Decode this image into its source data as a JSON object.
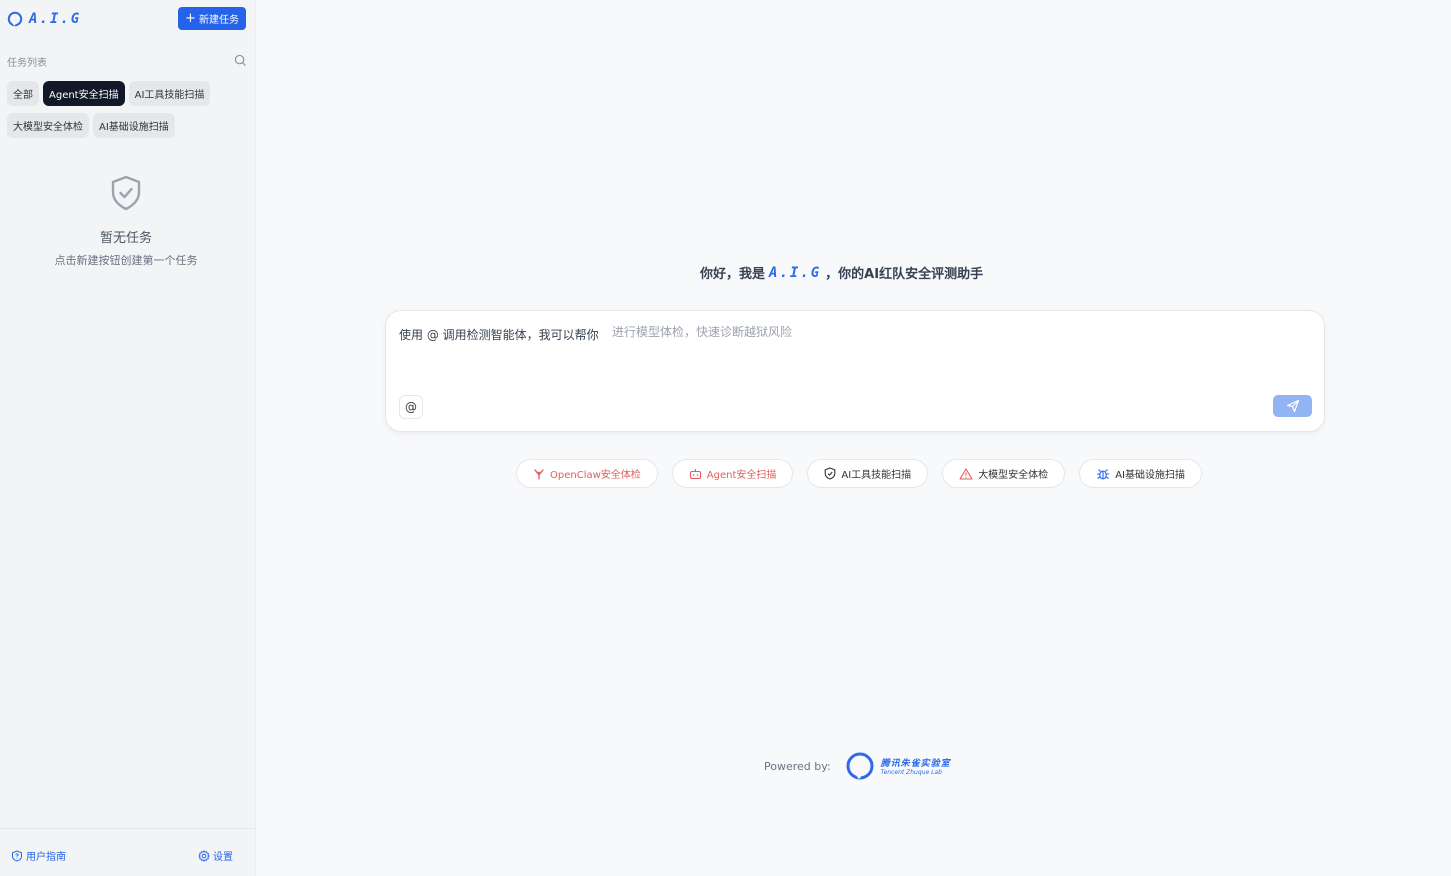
{
  "sidebar": {
    "logo_text": "A.I.G",
    "new_task_label": "新建任务",
    "task_list_label": "任务列表",
    "filters_row1": [
      "全部",
      "Agent安全扫描",
      "AI工具技能扫描"
    ],
    "filters_row2": [
      "大模型安全体检",
      "AI基础设施扫描"
    ],
    "active_filter": "Agent安全扫描",
    "empty_title": "暂无任务",
    "empty_subtitle": "点击新建按钮创建第一个任务",
    "footer": {
      "guide_label": "用户指南",
      "settings_label": "设置"
    }
  },
  "main": {
    "greeting_prefix": "你好，我是",
    "greeting_brand": "A.I.G",
    "greeting_suffix": "，你的AI红队安全评测助手",
    "input": {
      "prefix": "使用 @ 调用检测智能体，我可以帮你",
      "placeholder": "进行模型体检，快速诊断越狱风险",
      "value": ""
    },
    "at_symbol": "@",
    "quick_actions": [
      {
        "label": "OpenClaw安全体检",
        "icon": "claw-icon",
        "color": "#e35d5d"
      },
      {
        "label": "Agent安全扫描",
        "icon": "robot-icon",
        "color": "#e35d5d"
      },
      {
        "label": "AI工具技能扫描",
        "icon": "shield-icon",
        "color": "#333333"
      },
      {
        "label": "大模型安全体检",
        "icon": "warning-icon",
        "color": "#333333"
      },
      {
        "label": "AI基础设施扫描",
        "icon": "bug-icon",
        "color": "#333333"
      }
    ],
    "powered_label": "Powered by:",
    "lab_name_cn": "腾讯朱雀实验室",
    "lab_name_en": "Tencent Zhuque Lab"
  },
  "colors": {
    "accent": "#2563eb",
    "brand": "#2f6be6",
    "active_chip": "#111827",
    "alert": "#e35d5d"
  }
}
